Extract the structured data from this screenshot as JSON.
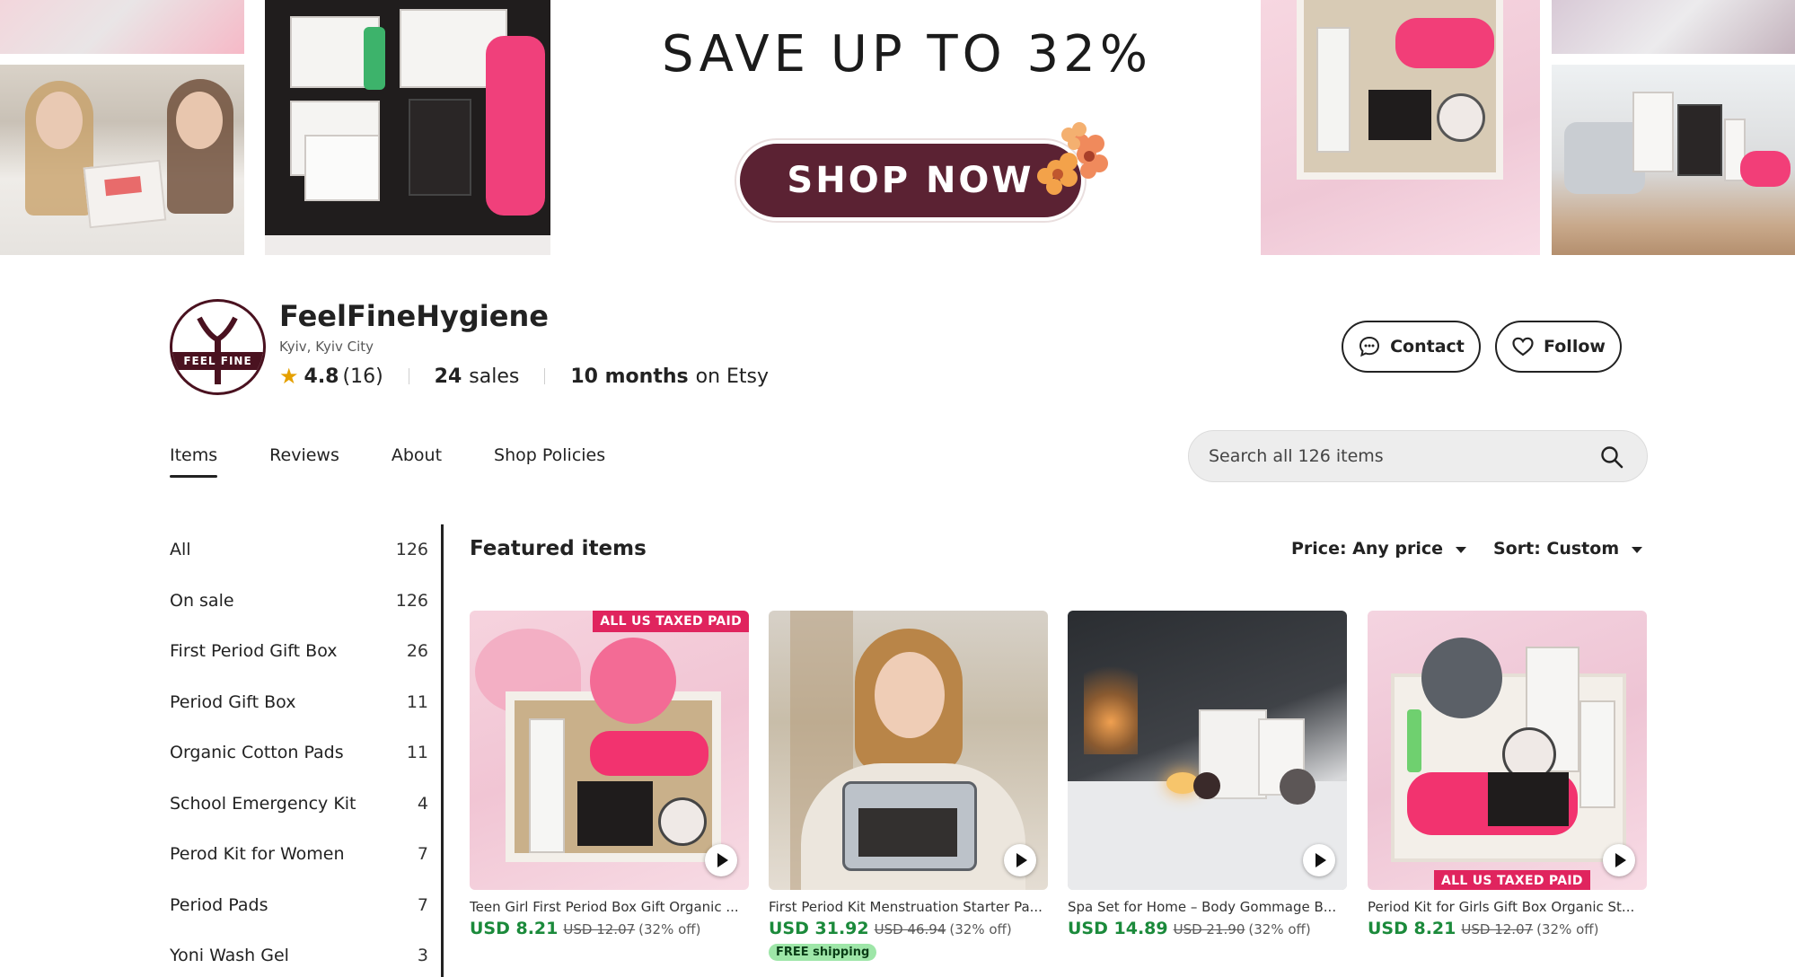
{
  "banner": {
    "headline": "SAVE UP TO 32%",
    "cta_label": "SHOP NOW"
  },
  "shop": {
    "logo_text": "FEEL FINE",
    "name": "FeelFineHygiene",
    "location": "Kyiv, Kyiv City",
    "rating": "4.8",
    "rating_count": "(16)",
    "sales_count": "24",
    "sales_label": "sales",
    "tenure": "10 months",
    "tenure_suffix": "on Etsy",
    "contact_label": "Contact",
    "follow_label": "Follow"
  },
  "tabs": [
    {
      "label": "Items",
      "active": true
    },
    {
      "label": "Reviews"
    },
    {
      "label": "About"
    },
    {
      "label": "Shop Policies"
    }
  ],
  "search": {
    "placeholder": "Search all 126 items"
  },
  "sidebar": {
    "items": [
      {
        "label": "All",
        "count": "126"
      },
      {
        "label": "On sale",
        "count": "126"
      },
      {
        "label": "First Period Gift Box",
        "count": "26"
      },
      {
        "label": "Period Gift Box",
        "count": "11"
      },
      {
        "label": "Organic Cotton Pads",
        "count": "11"
      },
      {
        "label": "School Emergency Kit",
        "count": "4"
      },
      {
        "label": "Perod Kit for Women",
        "count": "7"
      },
      {
        "label": "Period Pads",
        "count": "7"
      },
      {
        "label": "Yoni Wash Gel",
        "count": "3"
      }
    ]
  },
  "featured": {
    "title": "Featured items",
    "price_filter": "Price: Any price",
    "sort_filter": "Sort: Custom",
    "products": [
      {
        "title": "Teen Girl First Period Box Gift Organic ...",
        "price": "USD 8.21",
        "original_price": "USD 12.07",
        "discount": "(32% off)",
        "badge": "ALL US TAXED PAID"
      },
      {
        "title": "First Period Kit Menstruation Starter Pa...",
        "price": "USD 31.92",
        "original_price": "USD 46.94",
        "discount": "(32% off)",
        "shipping": "FREE shipping"
      },
      {
        "title": "Spa Set for Home – Body Gommage B...",
        "price": "USD 14.89",
        "original_price": "USD 21.90",
        "discount": "(32% off)"
      },
      {
        "title": "Period Kit for Girls Gift Box Organic St...",
        "price": "USD 8.21",
        "original_price": "USD 12.07",
        "discount": "(32% off)",
        "badge": "ALL US TAXED PAID"
      }
    ]
  },
  "colors": {
    "brand": "#5b2233",
    "price_green": "#1b8a3b",
    "badge_pink": "#e0245e",
    "free_shipping_bg": "#9ee6a8",
    "star": "#e5a000"
  }
}
